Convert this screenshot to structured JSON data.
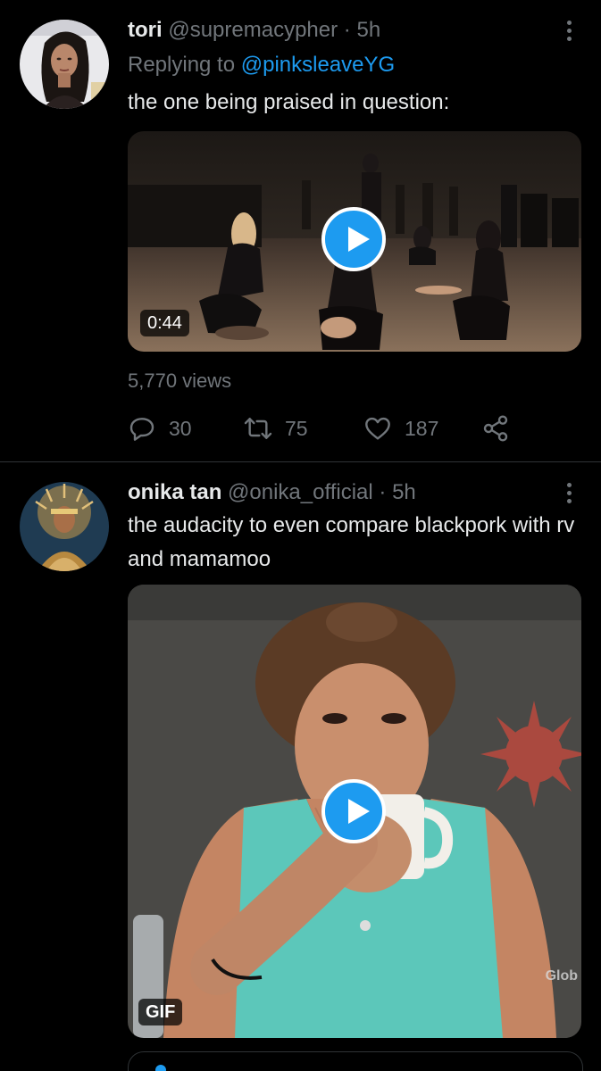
{
  "colors": {
    "background": "#000000",
    "text_primary": "#e7e9ea",
    "text_secondary": "#71767b",
    "accent": "#1d9bf0",
    "divider": "#2f3336"
  },
  "tweets": [
    {
      "name": "tori",
      "handle": "@supremacypher",
      "separator": "·",
      "time": "5h",
      "reply_prefix": "Replying to",
      "reply_to": "@pinksleaveYG",
      "text": "the one being praised in question:",
      "media": {
        "kind": "video",
        "duration": "0:44",
        "play_icon": "play-icon"
      },
      "views": "5,770 views",
      "actions": {
        "replies": "30",
        "retweets": "75",
        "likes": "187"
      }
    },
    {
      "name": "onika tan",
      "handle": "@onika_official",
      "separator": "·",
      "time": "5h",
      "text": "the audacity to even compare blackpork with rv and mamamoo",
      "media": {
        "kind": "gif",
        "badge": "GIF",
        "watermark": "Glob",
        "play_icon": "play-icon"
      }
    }
  ],
  "icons": [
    "more-vertical-icon",
    "reply-icon",
    "retweet-icon",
    "like-icon",
    "share-icon",
    "play-icon"
  ]
}
